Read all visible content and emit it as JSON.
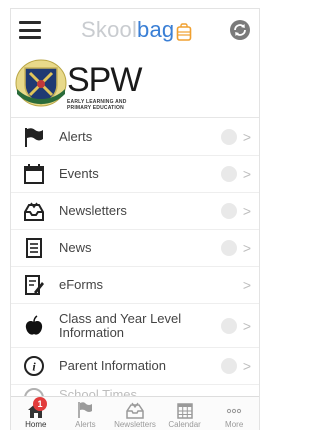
{
  "appbar": {
    "brand_part1": "Skool",
    "brand_part2": "bag"
  },
  "school": {
    "name": "SPW",
    "subtitle_line1": "EARLY LEARNING AND",
    "subtitle_line2": "PRIMARY EDUCATION"
  },
  "menu": [
    {
      "label": "Alerts",
      "icon": "flag-icon"
    },
    {
      "label": "Events",
      "icon": "calendar-icon"
    },
    {
      "label": "Newsletters",
      "icon": "inbox-icon"
    },
    {
      "label": "News",
      "icon": "document-icon"
    },
    {
      "label": "eForms",
      "icon": "form-pen-icon"
    },
    {
      "label": "Class and Year Level Information",
      "icon": "apple-icon"
    },
    {
      "label": "Parent Information",
      "icon": "info-icon"
    },
    {
      "label": "School Times",
      "icon": "clock-icon"
    }
  ],
  "tabbar": {
    "tabs": [
      {
        "label": "Home",
        "icon": "home-icon",
        "active": true,
        "badge": "1"
      },
      {
        "label": "Alerts",
        "icon": "flag-icon"
      },
      {
        "label": "Newsletters",
        "icon": "inbox-icon"
      },
      {
        "label": "Calendar",
        "icon": "calendar-grid-icon"
      },
      {
        "label": "More",
        "icon": "more-dots-icon"
      }
    ]
  },
  "colors": {
    "brand_gray": "#c9ccd0",
    "brand_blue": "#3a7fd5",
    "bag_orange": "#f0a030",
    "badge_red": "#e23b3b"
  }
}
